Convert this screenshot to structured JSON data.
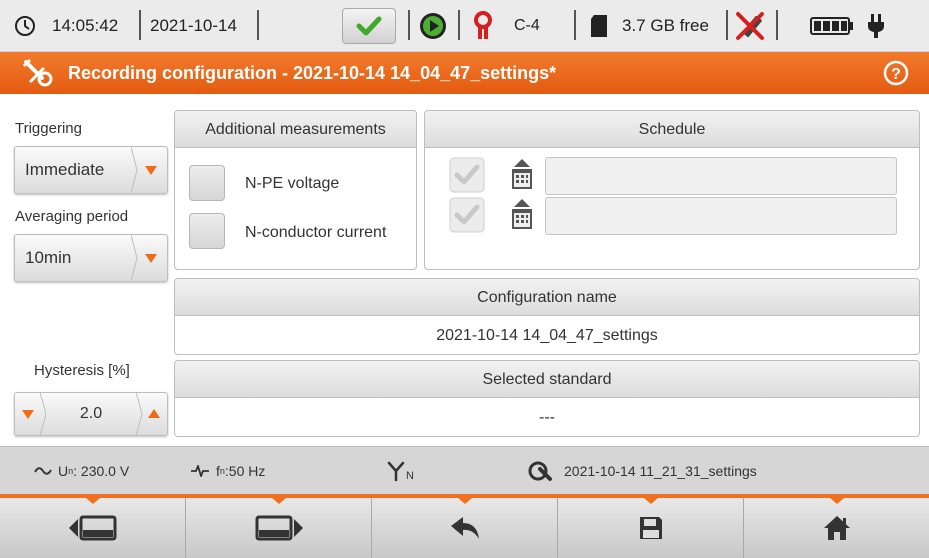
{
  "status": {
    "time": "14:05:42",
    "date": "2021-10-14",
    "clamp_label": "C-4",
    "storage_free": "3.7 GB free"
  },
  "titlebar": {
    "title": "Recording configuration - 2021-10-14 14_04_47_settings*"
  },
  "left": {
    "triggering_label": "Triggering",
    "triggering_value": "Immediate",
    "averaging_label": "Averaging period",
    "averaging_value": "10min",
    "hysteresis_label": "Hysteresis [%]",
    "hysteresis_value": "2.0"
  },
  "additional": {
    "header": "Additional measurements",
    "npe_label": "N-PE voltage",
    "nc_label": "N-conductor current"
  },
  "schedule": {
    "header": "Schedule"
  },
  "config_name": {
    "header": "Configuration name",
    "value": "2021-10-14 14_04_47_settings"
  },
  "standard": {
    "header": "Selected standard",
    "value": "---"
  },
  "infobar": {
    "un_prefix": "U",
    "un_sub": "n",
    "un_value": ": 230.0 V",
    "fn_prefix": "f",
    "fn_sub": "n",
    "fn_value": ":50 Hz",
    "network_sub": "N",
    "settings_file": "2021-10-14 11_21_31_settings"
  },
  "colors": {
    "accent": "#f07020",
    "titlebar": "#e8651b",
    "status_green": "#4caf32"
  }
}
